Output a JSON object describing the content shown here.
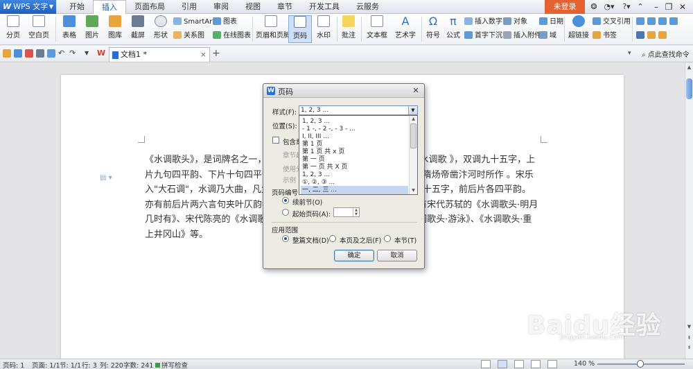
{
  "app": {
    "name": "WPS 文字",
    "logo": "W"
  },
  "menu_tabs": [
    "开始",
    "插入",
    "页面布局",
    "引用",
    "审阅",
    "视图",
    "章节",
    "开发工具",
    "云服务"
  ],
  "active_tab": "插入",
  "account": {
    "login_label": "未登录"
  },
  "ribbon": {
    "pagebreak": "分页",
    "blankpage": "空白页",
    "table": "表格",
    "picture": "图片",
    "gallery": "图库",
    "screenshot": "截屏",
    "shape": "形状",
    "smartart": "SmartArt",
    "chart": "图表",
    "relation": "关系图",
    "online_chart": "在线图表",
    "header_footer": "页眉和页脚",
    "page_number": "页码",
    "watermark": "水印",
    "comment": "批注",
    "textbox": "文本框",
    "wordart": "艺术字",
    "symbol": "符号",
    "formula": "公式",
    "insert_number": "插入数字",
    "object": "对象",
    "dropcap": "首字下沉",
    "attachment": "插入附件",
    "date": "日期",
    "field": "域",
    "hyperlink": "超链接",
    "crossref": "交叉引用",
    "bookmark": "书签"
  },
  "document_tab": {
    "title": "文档1 *"
  },
  "find_command": "点此查找命令",
  "document": {
    "paragraph": "《水调歌头》，是词牌名之一，又名《元会曲》、《凯歌》、《台城游》、《水调歌 》，双调九十五字，上片九句四平韵、下片十句四平韵，亦有用仄韵者。 据《隋唐嘉话》，为隋炀帝凿汴河时所作 。宋乐入\"大石调\"，水调乃大曲，凡大曲有\"歌头\"，此殆裁截其首段为之。九十五字，前后片各四平韵。亦有前后片两六言句夹叶仄韵者，有平仄互叶几于句句用韵者。 名篇有宋代苏轼的《水调歌头·明月几时有》、宋代陈亮的《水调歌头·送章德茂大卿使虏》，毛泽东的《水调歌头·游泳》、《水调歌头·重上井冈山》等。"
  },
  "dialog": {
    "title": "页码",
    "style_label": "样式(F):",
    "style_value": "1, 2, 3 ...",
    "position_label": "位置(S):",
    "include_chapter_label": "包含章",
    "chapter_start_label": "章节起",
    "separator_label": "使用分",
    "example_label": "示例",
    "numbering_label": "页码编号:",
    "continue_label": "续前节(O)",
    "start_at_label": "起始页码(A):",
    "start_at_value": "",
    "scope_label": "应用范围",
    "scope_whole": "整篇文档(D)",
    "scope_after": "本页及之后(F)",
    "scope_section": "本节(T)",
    "ok_label": "确定",
    "cancel_label": "取消",
    "style_options": [
      "1, 2, 3 ...",
      "- 1 -, - 2 -, - 3 - ...",
      "I, II, III ...",
      "第 1 页",
      "第 1 页 共 x 页",
      "第 一 页",
      "第 一 页 共 X 页",
      "1, 2, 3 ...",
      "①, ②, ③ ...",
      "一, 二, 三 ..."
    ],
    "highlighted_option_index": 9
  },
  "status": {
    "page_num": "页码: 1",
    "pages": "页面: 1/1",
    "section": "节: 1/1",
    "row": "行: 3",
    "col": "列: 220",
    "word_count": "字数: 241",
    "spell_check": "拼写检查",
    "zoom": "140 %"
  },
  "watermark": {
    "logo": "Baidu经验",
    "url": "jingyan.baidu.com"
  },
  "colors": {
    "accent": "#1f5fbf",
    "login": "#e5612f",
    "selected": "#cfe0f6"
  }
}
